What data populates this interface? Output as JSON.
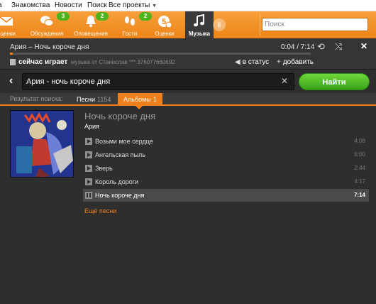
{
  "topbar": {
    "links": [
      "Знакомства",
      "Новости",
      "Поиск",
      "Все проекты"
    ]
  },
  "nav": {
    "items": [
      {
        "label": "оценки",
        "icon": "envelope-icon",
        "badge": ""
      },
      {
        "label": "Обсуждения",
        "icon": "chat-bubbles-icon",
        "badge": "3"
      },
      {
        "label": "Оповещения",
        "icon": "bell-icon",
        "badge": "2"
      },
      {
        "label": "Гости",
        "icon": "footprints-icon",
        "badge": "2"
      },
      {
        "label": "Оценки",
        "icon": "rating-five-icon",
        "badge": ""
      },
      {
        "label": "Музыка",
        "icon": "music-note-icon",
        "badge": ""
      }
    ],
    "search_placeholder": "Поиск",
    "accent": "#ee8417",
    "badge_color": "#4eb31d"
  },
  "player": {
    "now_title": "Ария – Ночь короче дня",
    "time": "0:04 / 7:14",
    "progress_fraction": 0.01,
    "now_playing_label": "сейчас играет",
    "now_playing_sub": "музыка от Станислав *** 376077660692",
    "to_status": "в статус",
    "add": "добавить"
  },
  "search": {
    "query": "Ария - ночь короче дня",
    "button": "Найти"
  },
  "tabs": {
    "results_label": "Результат поиска:",
    "items": [
      {
        "label": "Песни",
        "count": "1154",
        "active": false
      },
      {
        "label": "Альбомы",
        "count": "1",
        "active": true
      }
    ]
  },
  "album": {
    "title": "Ночь короче дня",
    "artist": "Ария",
    "tracks": [
      {
        "name": "Возьми мое сердце",
        "duration": "4:08",
        "playing": false
      },
      {
        "name": "Ангельская пыль",
        "duration": "6:00",
        "playing": false
      },
      {
        "name": "Зверь",
        "duration": "2:44",
        "playing": false
      },
      {
        "name": "Король дороги",
        "duration": "4:17",
        "playing": false
      },
      {
        "name": "Ночь короче дня",
        "duration": "7:14",
        "playing": true
      }
    ],
    "more": "Ещё песни"
  }
}
